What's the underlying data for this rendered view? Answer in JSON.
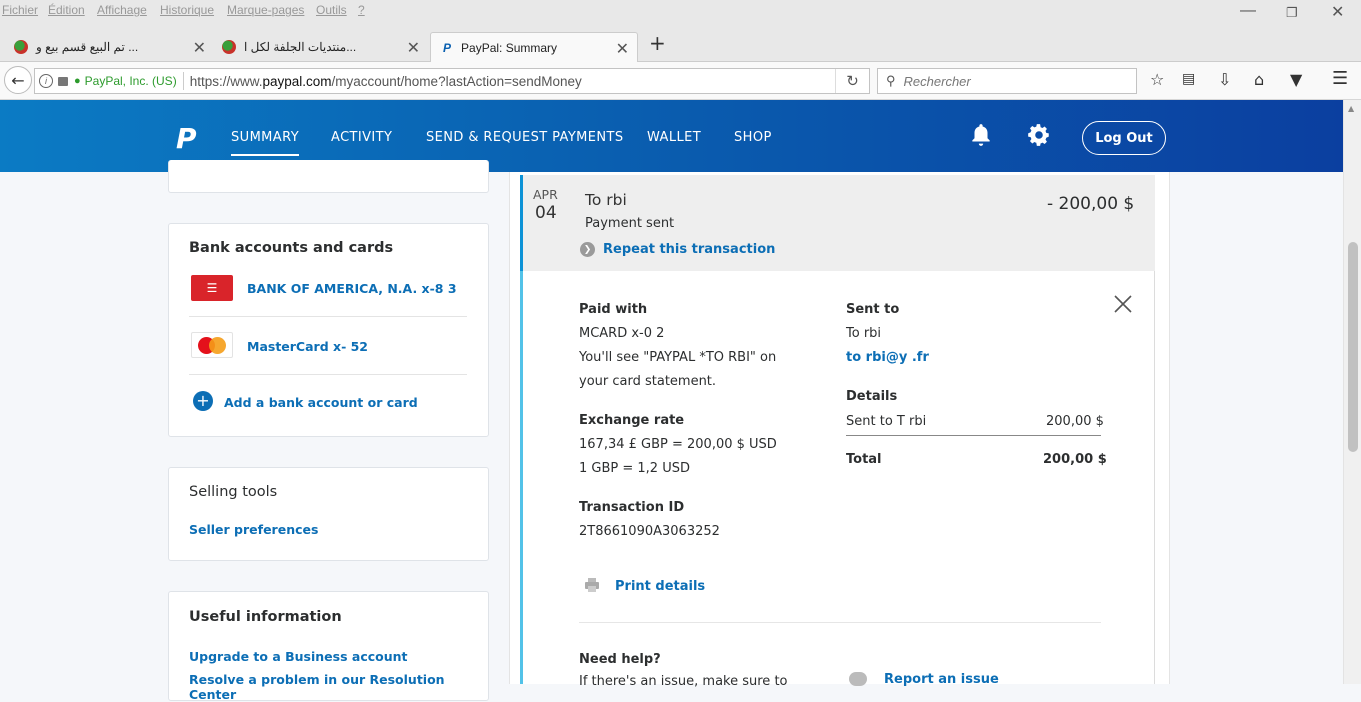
{
  "browser": {
    "menu": [
      "Fichier",
      "Édition",
      "Affichage",
      "Historique",
      "Marque-pages",
      "Outils",
      "?"
    ],
    "tabs": [
      {
        "title": "تم البيع قسم بيع و ..."
      },
      {
        "title": "منتديات الجلفة لكل ا..."
      },
      {
        "title": "PayPal: Summary"
      }
    ],
    "url_org": "PayPal, Inc. (US)",
    "url_prefix": "https://www.",
    "url_domain": "paypal.com",
    "url_path": "/myaccount/home?lastAction=sendMoney",
    "search_placeholder": "Rechercher"
  },
  "header": {
    "logo": "P",
    "nav": [
      "SUMMARY",
      "ACTIVITY",
      "SEND & REQUEST PAYMENTS",
      "WALLET",
      "SHOP"
    ],
    "logout": "Log Out"
  },
  "sidebar": {
    "bank_title": "Bank accounts and cards",
    "bank_items": [
      "BANK OF AMERICA, N.A. x-8  3",
      "MasterCard x-  52"
    ],
    "add_link": "Add a bank account or card",
    "selling_title": "Selling tools",
    "seller_link": "Seller preferences",
    "useful_title": "Useful information",
    "useful_links": [
      "Upgrade to a Business account",
      "Resolve a problem in our Resolution Center"
    ]
  },
  "transaction": {
    "month": "APR",
    "day": "04",
    "to": "To         rbi",
    "status": "Payment sent",
    "amount": "- 200,00 $",
    "repeat": "Repeat this transaction",
    "paid_with_label": "Paid with",
    "paid_with": "MCARD x-0  2",
    "statement_1": "You'll see \"PAYPAL *TO            RBI\" on",
    "statement_2": "your card statement.",
    "exchange_label": "Exchange rate",
    "exchange_1": "167,34 £ GBP = 200,00 $ USD",
    "exchange_2": "1 GBP = 1,2 USD",
    "txid_label": "Transaction ID",
    "txid": "2T8661090A3063252",
    "print": "Print details",
    "sent_to_label": "Sent to",
    "sent_to_name": "To      rbi",
    "sent_to_email": "to        rbi@y     .fr",
    "details_label": "Details",
    "details_row_label": "Sent to T         rbi",
    "details_row_value": "200,00 $",
    "total_label": "Total",
    "total_value": "200,00 $",
    "help_label": "Need help?",
    "help_text": "If there's an issue, make sure to",
    "report": "Report an issue"
  }
}
